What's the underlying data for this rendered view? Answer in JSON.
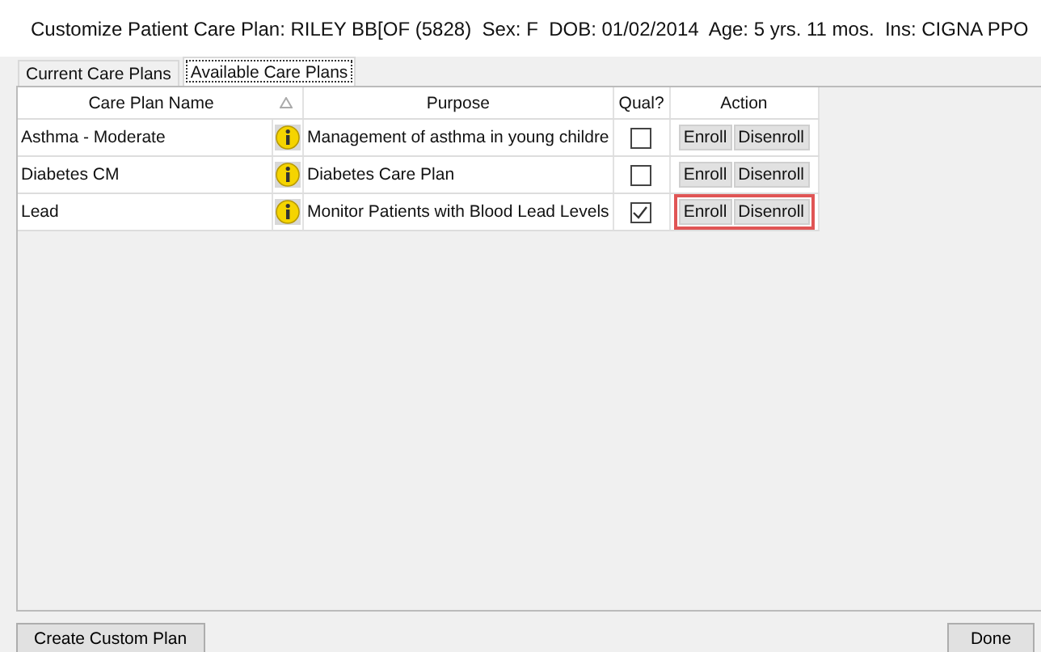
{
  "window": {
    "title": "Customize Patient Care Plan: RILEY BB[OF (5828)  Sex: F  DOB: 01/02/2014  Age: 5 yrs. 11 mos.  Ins: CIGNA PPO"
  },
  "tabs": [
    {
      "label": "Current Care Plans",
      "selected": false
    },
    {
      "label": "Available Care Plans",
      "selected": true
    }
  ],
  "table": {
    "columns": [
      "Care Plan Name",
      "Purpose",
      "Qual?",
      "Action"
    ],
    "rows": [
      {
        "name": "Asthma - Moderate",
        "purpose": "Management of asthma in young childre",
        "qualified": false,
        "actions": [
          "Enroll",
          "Disenroll"
        ],
        "highlighted": false
      },
      {
        "name": "Diabetes CM",
        "purpose": "Diabetes Care Plan",
        "qualified": false,
        "actions": [
          "Enroll",
          "Disenroll"
        ],
        "highlighted": false
      },
      {
        "name": "Lead",
        "purpose": "Monitor Patients with Blood Lead Levels",
        "qualified": true,
        "actions": [
          "Enroll",
          "Disenroll"
        ],
        "highlighted": true
      }
    ]
  },
  "buttons": [
    "Create Custom Plan",
    "Done"
  ]
}
